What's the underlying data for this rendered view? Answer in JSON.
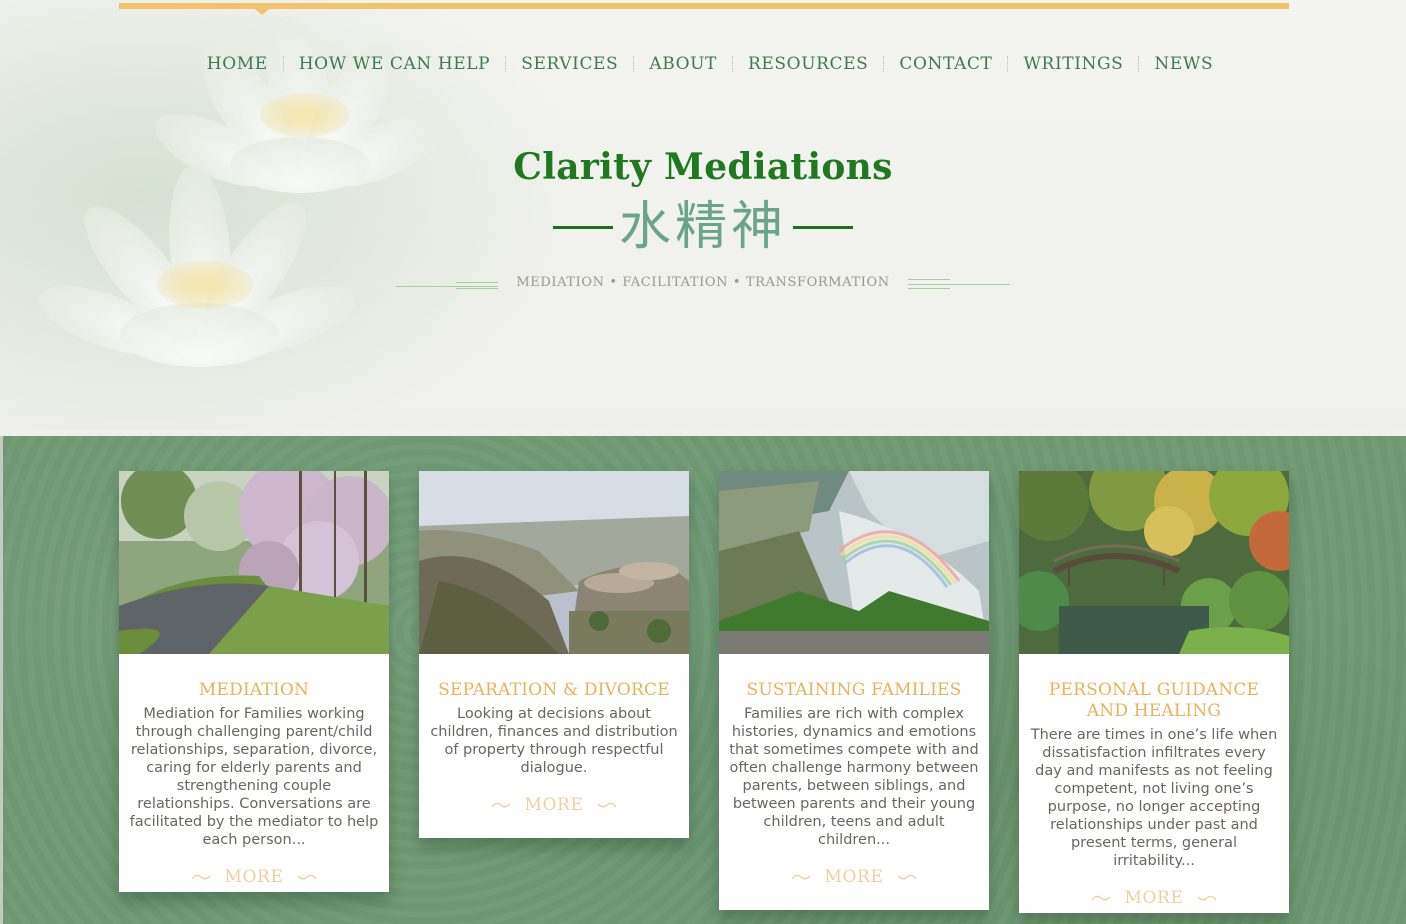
{
  "site": {
    "brand_title": "Clarity Mediations",
    "brand_cjk": "水精神",
    "tagline": "MEDIATION • FACILITATION • TRANSFORMATION"
  },
  "nav": {
    "items": [
      {
        "label": "HOME"
      },
      {
        "label": "HOW WE CAN HELP"
      },
      {
        "label": "SERVICES"
      },
      {
        "label": "ABOUT"
      },
      {
        "label": "RESOURCES"
      },
      {
        "label": "CONTACT"
      },
      {
        "label": "WRITINGS"
      },
      {
        "label": "NEWS"
      }
    ]
  },
  "cards": [
    {
      "title": "MEDIATION",
      "text": "Mediation for Families working through challenging parent/child relationships, separation, divorce, caring for elderly parents and strengthening couple relationships. Conversations are facilitated by the mediator to help each person...",
      "more": "MORE",
      "photo": "garden-path-with-blossoming-trees"
    },
    {
      "title": "SEPARATION & DIVORCE",
      "text": "Looking at decisions about children, finances and distribution of property through respectful dialogue.",
      "more": "MORE",
      "photo": "mountain-vista-with-rock-ledge"
    },
    {
      "title": "SUSTAINING FAMILIES",
      "text": "Families are rich with complex histories, dynamics and emotions that sometimes compete with and often challenge harmony between parents, between siblings, and between parents and their young children, teens and adult children...",
      "more": "MORE",
      "photo": "waterfall-mist-with-rainbow"
    },
    {
      "title": "PERSONAL GUIDANCE AND HEALING",
      "text": "There are times in one’s life when dissatisfaction infiltrates every day and manifests as not feeling competent, not living one’s purpose, no longer accepting relationships under past and present terms, general irritability...",
      "more": "MORE",
      "photo": "japanese-garden-bridge-over-pond"
    }
  ],
  "colors": {
    "nav_text": "#3e7a4f",
    "brand_title": "#1f7a1f",
    "cjk": "#6aa58a",
    "accent_gold": "#f0c26a",
    "card_title": "#eab15b",
    "green_panel": "#6e9a73"
  }
}
